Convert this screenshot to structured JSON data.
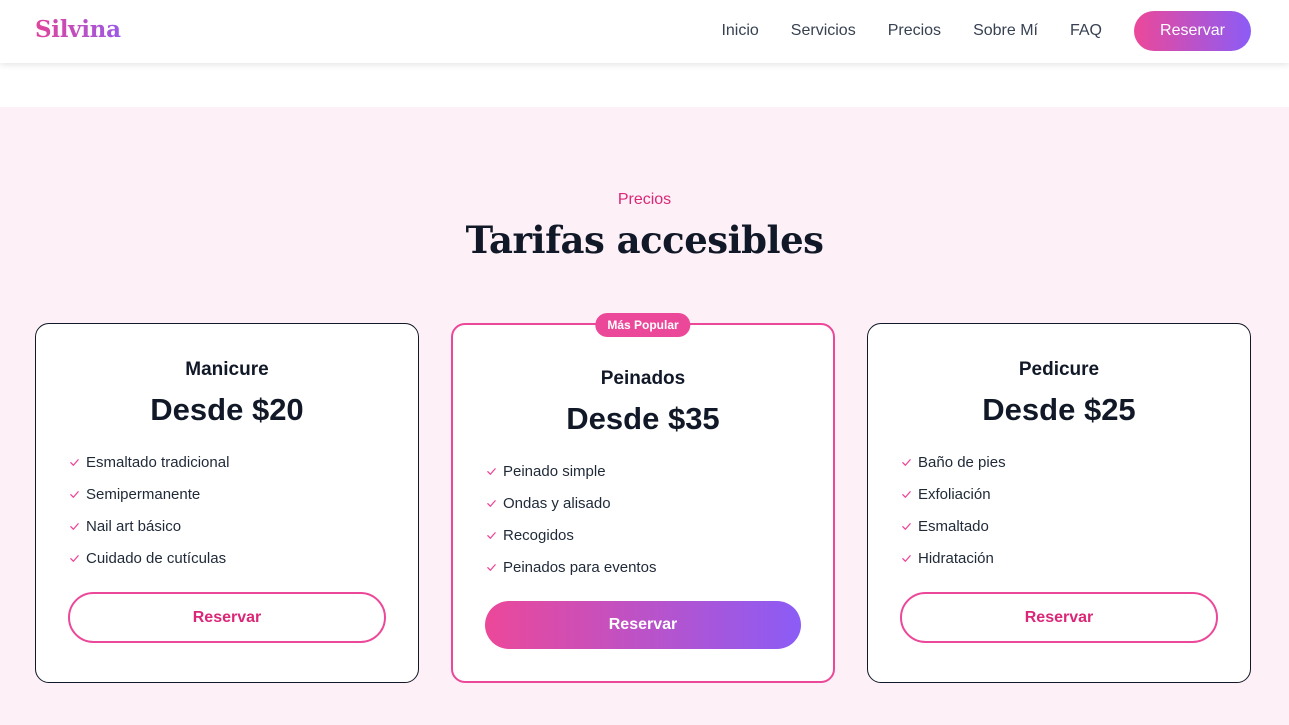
{
  "brand": {
    "logo": "Silvina"
  },
  "nav": {
    "links": [
      "Inicio",
      "Servicios",
      "Precios",
      "Sobre Mí",
      "FAQ"
    ],
    "cta": "Reservar"
  },
  "pricing": {
    "eyebrow": "Precios",
    "title": "Tarifas accesibles",
    "cards": [
      {
        "name": "Manicure",
        "price": "Desde $20",
        "features": [
          "Esmaltado tradicional",
          "Semipermanente",
          "Nail art básico",
          "Cuidado de cutículas"
        ],
        "button": "Reservar"
      },
      {
        "badge": "Más Popular",
        "name": "Peinados",
        "price": "Desde $35",
        "features": [
          "Peinado simple",
          "Ondas y alisado",
          "Recogidos",
          "Peinados para eventos"
        ],
        "button": "Reservar"
      },
      {
        "name": "Pedicure",
        "price": "Desde $25",
        "features": [
          "Baño de pies",
          "Exfoliación",
          "Esmaltado",
          "Hidratación"
        ],
        "button": "Reservar"
      }
    ]
  },
  "icons": {
    "feature_check": "check-icon"
  },
  "colors": {
    "accent_pink": "#ec4899",
    "accent_purple": "#8b5cf6",
    "section_bg": "#fdf0f6",
    "heading": "#111827"
  }
}
